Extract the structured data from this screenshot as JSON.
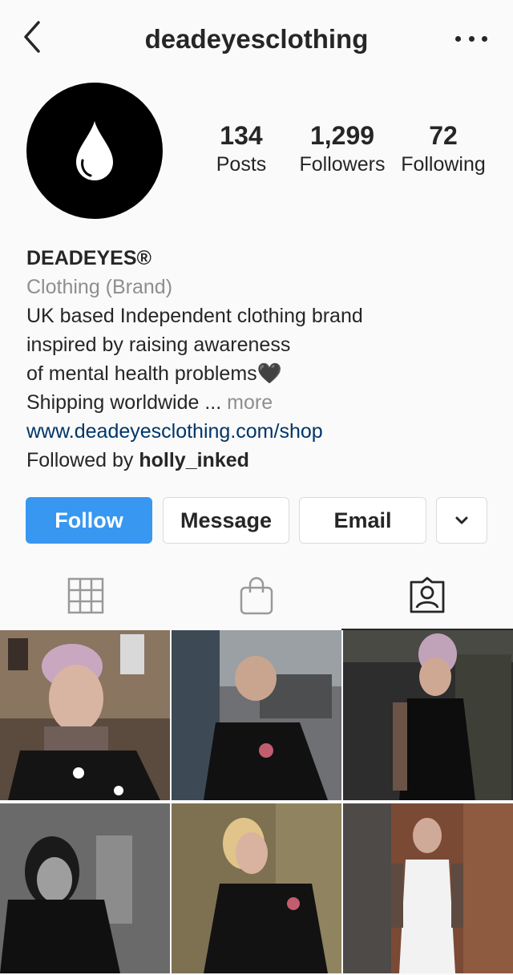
{
  "header": {
    "username": "deadeyesclothing"
  },
  "icons": {
    "back": "chevron-left-icon",
    "more": "more-horizontal-icon",
    "grid": "grid-icon",
    "shop": "shopping-bag-icon",
    "tagged": "tagged-person-icon",
    "dropdown": "chevron-down-icon"
  },
  "stats": {
    "posts": {
      "value": "134",
      "label": "Posts"
    },
    "followers": {
      "value": "1,299",
      "label": "Followers"
    },
    "following": {
      "value": "72",
      "label": "Following"
    }
  },
  "bio": {
    "name": "DEADEYES®",
    "category": "Clothing (Brand)",
    "line1": "UK based Independent clothing brand",
    "line2": "inspired by raising awareness",
    "line3": "of mental health problems🖤",
    "line4": "Shipping worldwide ...",
    "more_label": "more",
    "link": "www.deadeyesclothing.com/shop",
    "followed_by_prefix": "Followed by",
    "followed_by_user": "holly_inked"
  },
  "actions": {
    "follow": "Follow",
    "message": "Message",
    "email": "Email"
  },
  "colors": {
    "follow_button": "#3897f0",
    "link": "#003569",
    "secondary_text": "#8e8e8e",
    "border": "#dbdbdb"
  }
}
